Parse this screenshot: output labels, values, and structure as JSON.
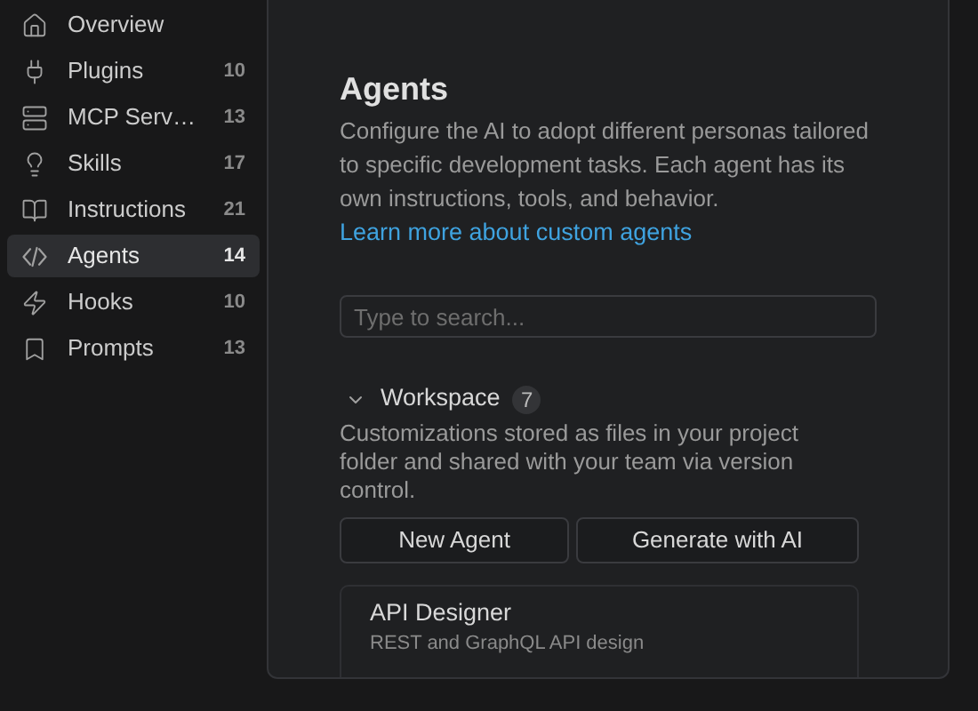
{
  "sidebar": {
    "items": [
      {
        "kind": "home",
        "label": "Overview",
        "selected": false
      },
      {
        "kind": "plug",
        "label": "Plugins",
        "count": "10",
        "selected": false
      },
      {
        "kind": "server",
        "label": "MCP Serv…",
        "count": "13",
        "selected": false
      },
      {
        "kind": "bulb",
        "label": "Skills",
        "count": "17",
        "selected": false
      },
      {
        "kind": "book",
        "label": "Instructions",
        "count": "21",
        "selected": false
      },
      {
        "kind": "agent",
        "label": "Agents",
        "count": "14",
        "selected": true
      },
      {
        "kind": "zap",
        "label": "Hooks",
        "count": "10",
        "selected": false
      },
      {
        "kind": "bookmark",
        "label": "Prompts",
        "count": "13",
        "selected": false
      }
    ]
  },
  "main": {
    "title": "Agents",
    "description": "Configure the AI to adopt different personas tailored to specific development tasks. Each agent has its own instructions, tools, and behavior.",
    "link": "Learn more about custom agents",
    "search": {
      "placeholder": "Type to search..."
    },
    "section": {
      "title": "Workspace",
      "count": "7",
      "expanded": true,
      "description": "Customizations stored as files in your project folder and shared with your team via version control.",
      "buttons": [
        "New Agent",
        "Generate with AI"
      ],
      "agents": [
        {
          "name": "API Designer",
          "description": "REST and GraphQL API design"
        }
      ]
    }
  }
}
